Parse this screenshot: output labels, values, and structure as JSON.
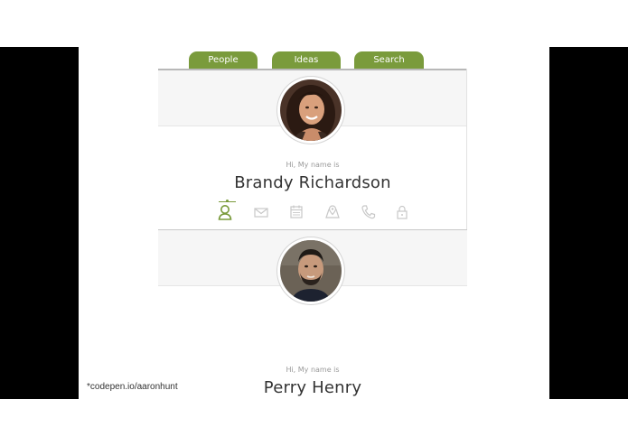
{
  "tabs": [
    {
      "label": "People"
    },
    {
      "label": "Ideas"
    },
    {
      "label": "Search"
    }
  ],
  "profiles": [
    {
      "greeting": "Hi, My name is",
      "name": "Brandy Richardson"
    },
    {
      "greeting": "Hi, My name is",
      "name": "Perry Henry"
    }
  ],
  "icon_names": [
    "user-icon",
    "mail-icon",
    "calendar-icon",
    "map-icon",
    "phone-icon",
    "lock-icon"
  ],
  "credit": "*codepen.io/aaronhunt",
  "colors": {
    "accent": "#7a9b3c",
    "icon_inactive": "#c8c8c8",
    "letterbox": "#000000"
  }
}
